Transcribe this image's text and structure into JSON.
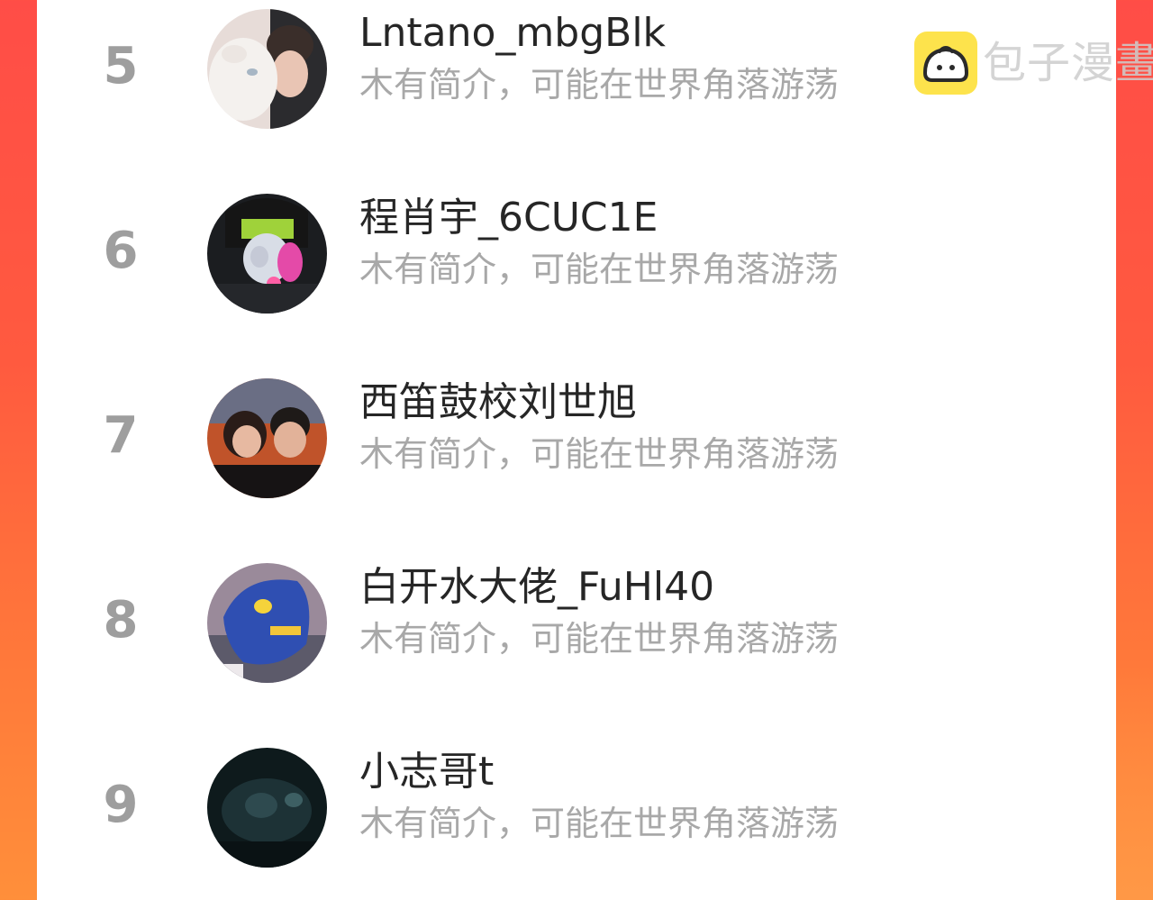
{
  "leaderboard": {
    "rows": [
      {
        "rank": "5",
        "name": "Lntano_mbgBlk",
        "desc": "木有简介，可能在世界角落游荡"
      },
      {
        "rank": "6",
        "name": "程肖宇_6CUC1E",
        "desc": "木有简介，可能在世界角落游荡"
      },
      {
        "rank": "7",
        "name": "西笛鼓校刘世旭",
        "desc": "木有简介，可能在世界角落游荡"
      },
      {
        "rank": "8",
        "name": "白开水大佬_FuHl40",
        "desc": "木有简介，可能在世界角落游荡"
      },
      {
        "rank": "9",
        "name": "小志哥t",
        "desc": "木有简介，可能在世界角落游荡"
      }
    ]
  },
  "watermark": {
    "text": "包子漫畫",
    "logo_icon": "steamed-bun-icon"
  },
  "colors": {
    "background_red": "#ff4d47",
    "background_orange": "#ff8f3a",
    "panel": "#ffffff",
    "rank_text": "#9e9e9e",
    "name_text": "#262626",
    "desc_text": "#a8a8a8",
    "watermark_logo": "#fde34c"
  }
}
